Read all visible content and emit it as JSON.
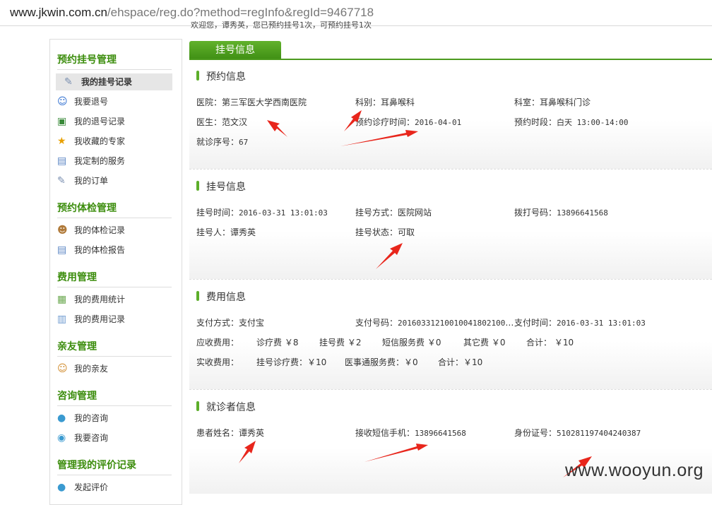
{
  "browser": {
    "url_host": "www.jkwin.com.cn",
    "url_path": "/ehspace/reg.do?method=regInfo&regId=9467718"
  },
  "top_notice": "欢迎您，谭秀英，您已预约挂号1次，可预约挂号1次",
  "sidebar": {
    "sections": [
      {
        "title": "预约挂号管理",
        "items": [
          {
            "label": "我的挂号记录",
            "icon": "notepad-icon",
            "active": true
          },
          {
            "label": "我要退号",
            "icon": "person-icon"
          },
          {
            "label": "我的退号记录",
            "icon": "computer-icon"
          },
          {
            "label": "我收藏的专家",
            "icon": "star-icon"
          },
          {
            "label": "我定制的服务",
            "icon": "card-icon"
          },
          {
            "label": "我的订单",
            "icon": "notepad-icon"
          }
        ]
      },
      {
        "title": "预约体检管理",
        "items": [
          {
            "label": "我的体检记录",
            "icon": "doctor-icon"
          },
          {
            "label": "我的体检报告",
            "icon": "card-icon"
          }
        ]
      },
      {
        "title": "费用管理",
        "items": [
          {
            "label": "我的费用统计",
            "icon": "chart-icon"
          },
          {
            "label": "我的费用记录",
            "icon": "document-icon"
          }
        ]
      },
      {
        "title": "亲友管理",
        "items": [
          {
            "label": "我的亲友",
            "icon": "friends-icon"
          }
        ]
      },
      {
        "title": "咨询管理",
        "items": [
          {
            "label": "我的咨询",
            "icon": "chat-icon"
          },
          {
            "label": "我要咨询",
            "icon": "search-icon"
          }
        ]
      },
      {
        "title": "管理我的评价记录",
        "items": [
          {
            "label": "发起评价",
            "icon": "chat-icon"
          }
        ]
      }
    ]
  },
  "tab_label": "挂号信息",
  "sections": {
    "appointment": {
      "title": "预约信息",
      "hospital": "医院：第三军医大学西南医院",
      "department": "科别：耳鼻喉科",
      "room": "科室：耳鼻喉科门诊",
      "doctor": "医生：范文汉",
      "visit_time_label": "预约诊疗时间：",
      "visit_time": "2016-04-01",
      "slot_label": "预约时段：",
      "slot": "白天 13:00-14:00",
      "seq_label": "就诊序号：",
      "seq": "67"
    },
    "registration": {
      "title": "挂号信息",
      "time_label": "挂号时间：",
      "time": "2016-03-31 13:01:03",
      "method": "挂号方式：医院网站",
      "phone_label": "拨打号码：",
      "phone": "13896641568",
      "person": "挂号人：谭秀英",
      "status": "挂号状态：可取"
    },
    "fees": {
      "title": "费用信息",
      "pay_method": "支付方式：支付宝",
      "pay_no_label": "支付号码：",
      "pay_no": "20160331210010041802100111…",
      "pay_time_label": "支付时间：",
      "pay_time": "2016-03-31 13:01:03",
      "receivable_label": "应收费用：",
      "receivable": [
        "诊疗费 ￥8",
        "挂号费 ￥2",
        "短信服务费 ￥0",
        "其它费 ￥0",
        "合计： ￥10"
      ],
      "received_label": "实收费用：",
      "received": [
        "挂号诊疗费：￥10",
        "医事通服务费：￥0",
        "合计：￥10"
      ]
    },
    "patient": {
      "title": "就诊者信息",
      "name": "患者姓名：谭秀英",
      "sms_label": "接收短信手机：",
      "sms": "13896641568",
      "id_label": "身份证号：",
      "id": "510281197404240387"
    }
  },
  "watermark": "www.wooyun.org",
  "colors": {
    "accent": "#3c8d0d",
    "tab": "#4c9a1e",
    "arrow": "#e8261c"
  }
}
